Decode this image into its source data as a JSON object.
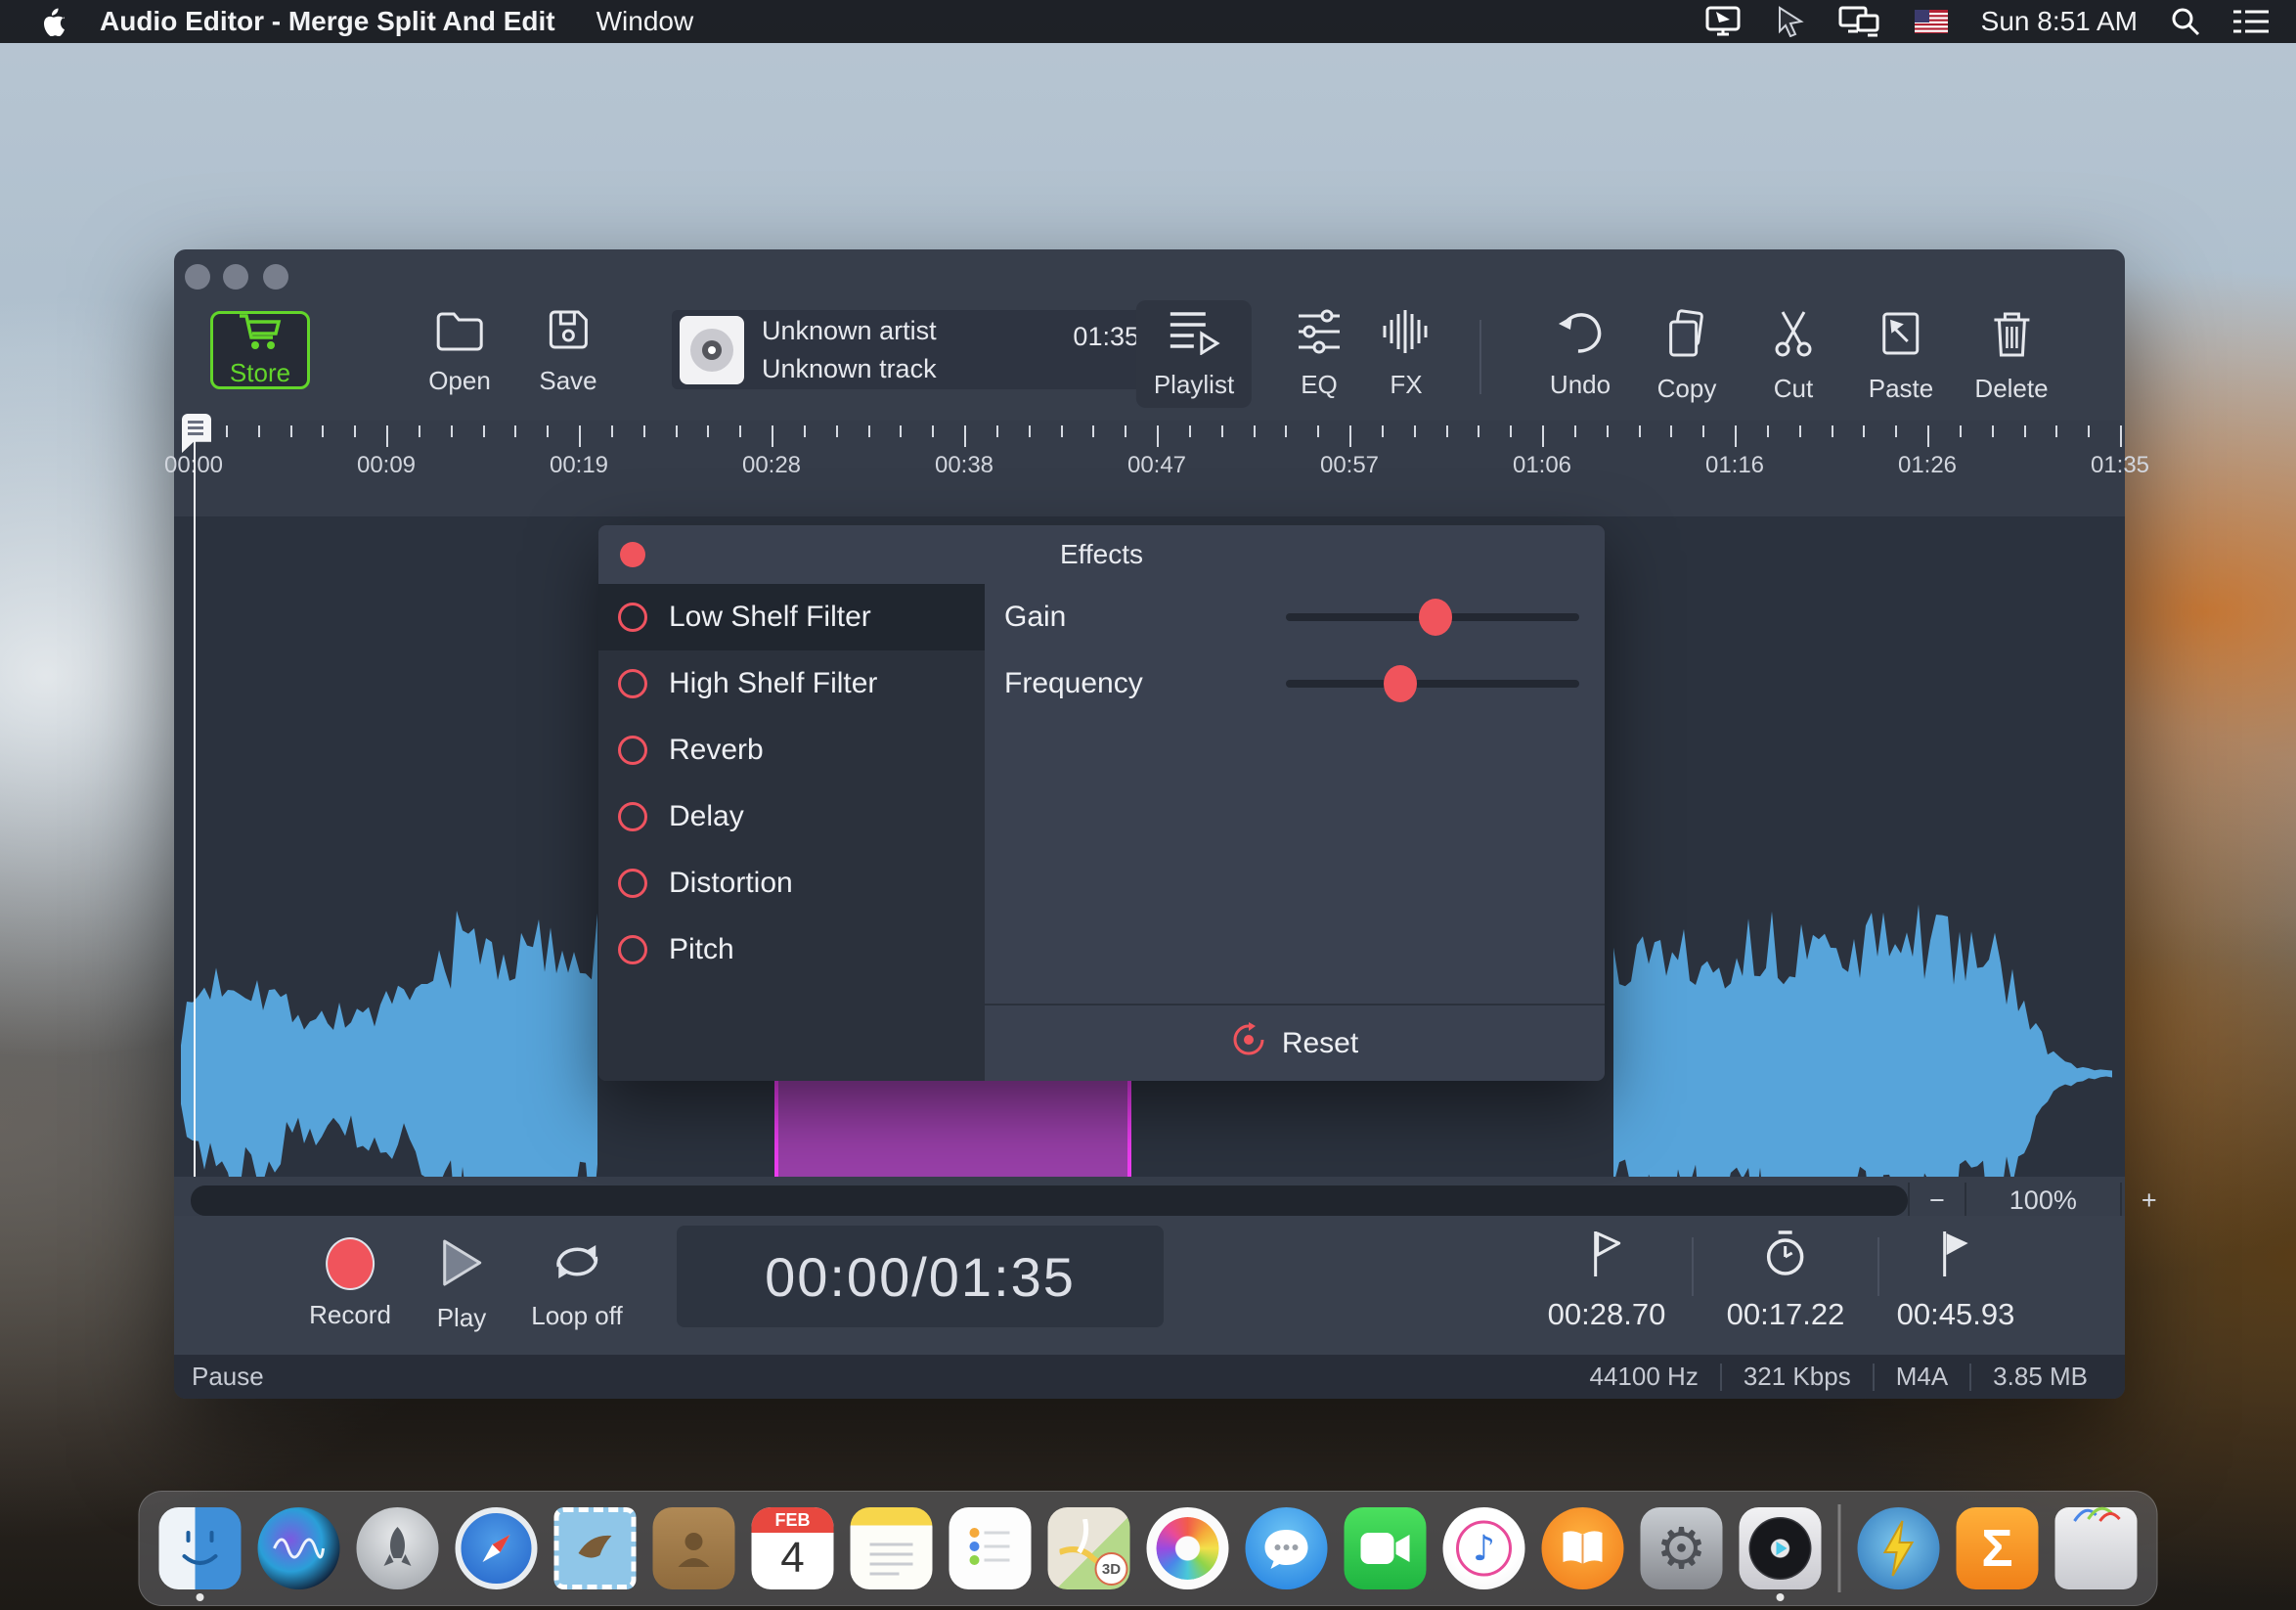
{
  "menu_bar": {
    "app_name": "Audio Editor - Merge Split And Edit",
    "menus": [
      "Window"
    ],
    "clock": "Sun 8:51 AM",
    "status_icons": [
      "airplay-display-icon",
      "pointer-icon",
      "dual-displays-icon",
      "us-flag-icon",
      "search-icon",
      "menu-list-icon"
    ]
  },
  "toolbar": {
    "store": {
      "label": "Store",
      "icon": "cart-icon",
      "accent_color": "#63d62a"
    },
    "items_left": [
      {
        "label": "Open",
        "icon": "folder-icon"
      },
      {
        "label": "Save",
        "icon": "save-icon"
      }
    ],
    "track_info": {
      "artist": "Unknown artist",
      "track": "Unknown track",
      "duration": "01:35",
      "icon": "disc-icon"
    },
    "items_right": [
      {
        "label": "Playlist",
        "icon": "playlist-icon",
        "active": true
      },
      {
        "label": "EQ",
        "icon": "eq-icon"
      },
      {
        "label": "FX",
        "icon": "fx-icon"
      },
      {
        "label": "Undo",
        "icon": "undo-icon"
      },
      {
        "label": "Copy",
        "icon": "copy-icon"
      },
      {
        "label": "Cut",
        "icon": "scissors-icon"
      },
      {
        "label": "Paste",
        "icon": "paste-icon"
      },
      {
        "label": "Delete",
        "icon": "trash-icon"
      }
    ]
  },
  "ruler": {
    "labels": [
      "00:00",
      "00:09",
      "00:19",
      "00:28",
      "00:38",
      "00:47",
      "00:57",
      "01:06",
      "01:16",
      "01:26",
      "01:35"
    ]
  },
  "selection": {
    "start": "00:28.70",
    "length": "00:17.22",
    "end": "00:45.93",
    "fill_color": "#983fa8",
    "edge_color": "#ee3df2"
  },
  "effects_dialog": {
    "title": "Effects",
    "items": [
      {
        "label": "Low Shelf Filter",
        "selected": true
      },
      {
        "label": "High Shelf Filter",
        "selected": false
      },
      {
        "label": "Reverb",
        "selected": false
      },
      {
        "label": "Delay",
        "selected": false
      },
      {
        "label": "Distortion",
        "selected": false
      },
      {
        "label": "Pitch",
        "selected": false
      }
    ],
    "controls": [
      {
        "label": "Gain",
        "value_pct": 51
      },
      {
        "label": "Frequency",
        "value_pct": 39
      }
    ],
    "reset_label": "Reset"
  },
  "transport": {
    "record_label": "Record",
    "play_label": "Play",
    "loop_label": "Loop off",
    "time_display": "00:00/01:35",
    "markers": [
      {
        "icon": "flag-outline-icon",
        "value": "00:28.70"
      },
      {
        "icon": "stopwatch-icon",
        "value": "00:17.22"
      },
      {
        "icon": "flag-filled-icon",
        "value": "00:45.93"
      }
    ]
  },
  "zoom_control": {
    "minus": "−",
    "level": "100%",
    "plus": "+"
  },
  "status_bar": {
    "state": "Pause",
    "stats": [
      "44100 Hz",
      "321 Kbps",
      "M4A",
      "3.85 MB"
    ]
  },
  "waveform": {
    "color": "#57a4da",
    "left_envelope": [
      [
        7,
        50
      ],
      [
        22,
        95
      ],
      [
        52,
        118
      ],
      [
        84,
        112
      ],
      [
        114,
        82
      ],
      [
        142,
        68
      ],
      [
        182,
        70
      ],
      [
        222,
        80
      ],
      [
        254,
        95
      ],
      [
        274,
        138
      ],
      [
        294,
        162
      ],
      [
        322,
        150
      ],
      [
        354,
        140
      ],
      [
        382,
        150
      ],
      [
        412,
        155
      ],
      [
        436,
        150
      ]
    ],
    "right_envelope": [
      [
        1472,
        148
      ],
      [
        1522,
        156
      ],
      [
        1582,
        148
      ],
      [
        1642,
        152
      ],
      [
        1702,
        150
      ],
      [
        1752,
        158
      ],
      [
        1797,
        162
      ],
      [
        1827,
        150
      ],
      [
        1857,
        138
      ],
      [
        1880,
        115
      ],
      [
        1897,
        70
      ],
      [
        1912,
        35
      ],
      [
        1927,
        18
      ],
      [
        1947,
        8
      ],
      [
        1985,
        3
      ]
    ]
  },
  "colors": {
    "window_chrome": "#373e4b",
    "wave_background": "#2b323e",
    "accent_red": "#f0545c",
    "store_green": "#63d62a",
    "waveform_blue": "#57a4da",
    "selection_purple": "#983fa8"
  },
  "dock": {
    "apps": [
      {
        "name": "Finder",
        "running": true
      },
      {
        "name": "Siri",
        "running": false
      },
      {
        "name": "Launchpad",
        "running": false
      },
      {
        "name": "Safari",
        "running": false
      },
      {
        "name": "Mail",
        "running": false
      },
      {
        "name": "Contacts",
        "running": false
      },
      {
        "name": "Calendar",
        "running": false
      },
      {
        "name": "Notes",
        "running": false
      },
      {
        "name": "Reminders",
        "running": false
      },
      {
        "name": "Maps",
        "running": false
      },
      {
        "name": "Photos",
        "running": false
      },
      {
        "name": "Messages",
        "running": false
      },
      {
        "name": "FaceTime",
        "running": false
      },
      {
        "name": "iTunes",
        "running": false
      },
      {
        "name": "iBooks",
        "running": false
      },
      {
        "name": "System Preferences",
        "running": false
      },
      {
        "name": "Audio Editor",
        "running": true
      },
      {
        "name": "separator",
        "running": false
      },
      {
        "name": "Lightning",
        "running": false
      },
      {
        "name": "Sigma",
        "running": false
      },
      {
        "name": "Trash",
        "running": false
      }
    ],
    "calendar_month": "FEB",
    "calendar_day": "4",
    "maps_badge": "3D",
    "sigma_glyph": "Σ"
  }
}
